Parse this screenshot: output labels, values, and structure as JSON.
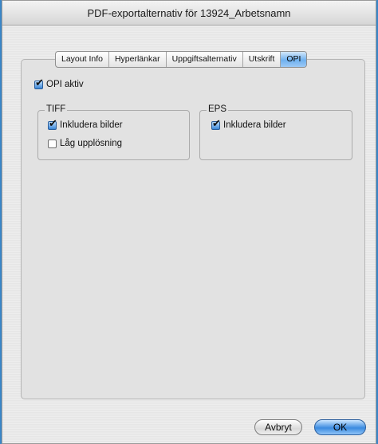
{
  "window": {
    "title": "PDF-exportalternativ för 13924_Arbetsnamn"
  },
  "tabs": [
    {
      "label": "Layout Info",
      "active": false
    },
    {
      "label": "Hyperlänkar",
      "active": false
    },
    {
      "label": "Uppgiftsalternativ",
      "active": false
    },
    {
      "label": "Utskrift",
      "active": false
    },
    {
      "label": "OPI",
      "active": true
    }
  ],
  "opi": {
    "active_label": "OPI aktiv",
    "active_checked": true,
    "tiff": {
      "legend": "TIFF",
      "include_images_label": "Inkludera bilder",
      "include_images_checked": true,
      "low_res_label": "Låg upplösning",
      "low_res_checked": false
    },
    "eps": {
      "legend": "EPS",
      "include_images_label": "Inkludera bilder",
      "include_images_checked": true
    }
  },
  "buttons": {
    "cancel_label": "Avbryt",
    "ok_label": "OK"
  },
  "colors": {
    "accent": "#3b8be0",
    "desktop": "#3a86c8"
  }
}
